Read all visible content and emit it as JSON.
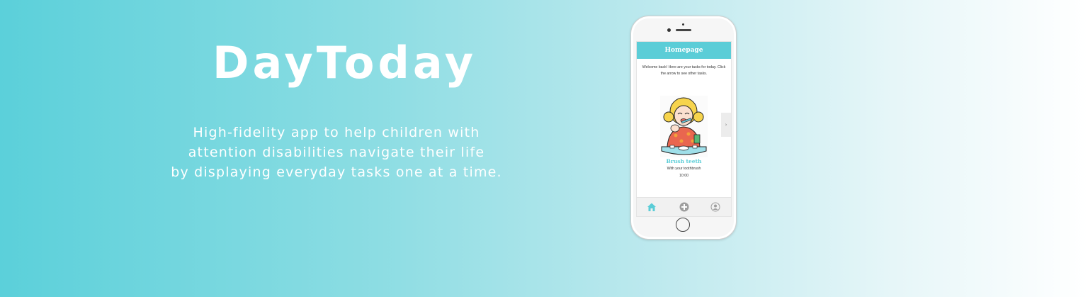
{
  "hero": {
    "title": "DayToday",
    "description": [
      "High-fidelity app to help children with",
      "attention disabilities navigate their life",
      "by displaying everyday tasks one at a time."
    ]
  },
  "app": {
    "header_title": "Homepage",
    "welcome": [
      "Welcome back! Here are your tasks for today. Click",
      "the arrow to see other tasks."
    ],
    "task": {
      "name": "Brush teeth",
      "subtitle": "With your toothbrush",
      "time": "10:00"
    },
    "next_arrow": "›",
    "tabs": [
      {
        "icon": "home-icon"
      },
      {
        "icon": "add-icon"
      },
      {
        "icon": "profile-icon"
      }
    ]
  },
  "colors": {
    "accent": "#5bcdd7",
    "background_start": "#5bd0da",
    "background_end": "#ffffff",
    "text_light": "#ffffff"
  }
}
